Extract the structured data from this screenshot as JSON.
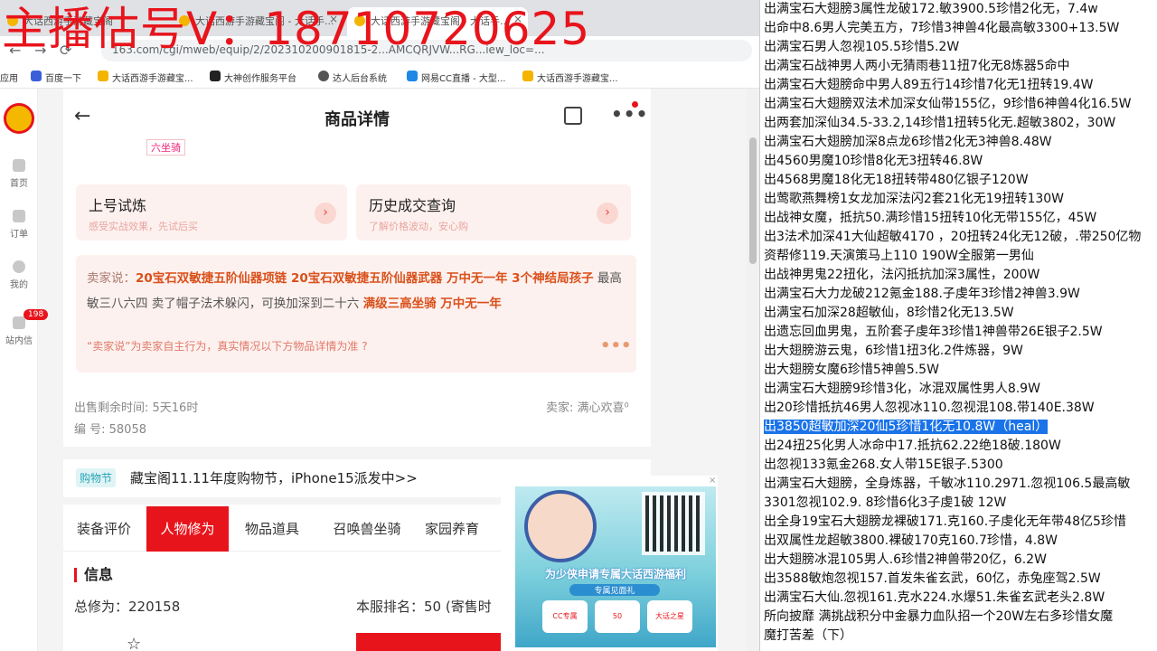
{
  "watermark": "主播估号V：18710720625",
  "browser": {
    "tabs": [
      {
        "label": "大话西游手游藏宝阁"
      },
      {
        "label": "大话西游手游藏宝阁 - 大话手..."
      },
      {
        "label": "大话西游手游藏宝阁 - 大话手..."
      }
    ],
    "url": "163.com/cgi/mweb/equip/2/202310200901815-2...AMCQRJVW...RG...iew_loc=...",
    "bookmarks": [
      "应用",
      "百度一下",
      "大话西游手游藏宝...",
      "大神创作服务平台",
      "达人后台系统",
      "网易CC直播 - 大型...",
      "大话西游手游藏宝..."
    ]
  },
  "sidenav": {
    "items": [
      {
        "label": "首页"
      },
      {
        "label": "订单"
      },
      {
        "label": "我的"
      },
      {
        "label": "站内信"
      }
    ],
    "message_badge": "198"
  },
  "detail": {
    "title": "商品详情",
    "back_icon": "arrow-left",
    "mount_tag": "六坐骑",
    "cards": [
      {
        "title": "上号试炼",
        "subtitle": "感受实战效果，先试后买",
        "arrow": "›"
      },
      {
        "title": "历史成交查询",
        "subtitle": "了解价格波动，安心购",
        "arrow": "›"
      }
    ],
    "seller_says": {
      "prefix": "卖家说：",
      "hl1": "20宝石双敏捷五阶仙器项链 20宝石双敏捷五阶仙器武器  万中无一年 3个神结局孩子",
      "plain1": " 最高敏三八六四 卖了帽子法术躲闪，可换加深到二十六 ",
      "hl2": "满级三高坐骑 万中无一年",
      "note": "“卖家说”为卖家自主行为，真实情况以下方物品详情为准",
      "note_icon": "?",
      "more": "•••"
    },
    "sale_time": "出售剩余时间: 5天16时",
    "seller": "卖家: 满心欢喜⁰",
    "serial": "编 号: 58058",
    "promo_tag": "购物节",
    "promo_text": "藏宝阁11.11年度购物节，iPhone15派发中>>",
    "tabs": [
      "装备评价",
      "人物修为",
      "物品道具",
      "召唤兽坐骑",
      "家园养育"
    ],
    "active_tab": "人物修为",
    "info_title": "信息",
    "total_cultivation": "总修为：220158",
    "server_rank": "本服排名：50 (寄售时"
  },
  "ad": {
    "headline": "为少侠申请专属大话西游福利",
    "sub": "专属见面礼",
    "prizes": [
      "CC专属",
      "50",
      "大话之星"
    ],
    "close": "×"
  },
  "panel": {
    "lines": [
      "出满宝石大翅膀3属性龙破172.敏3900.5珍惜2化无，7.4w",
      "出命中8.6男人完美五方，7珍惜3神兽4化最高敏3300+13.5W",
      "出满宝石男人忽视105.5珍惜5.2W",
      "出满宝石战神男人两小无猜雨巷11扭7化无8炼器5命中",
      "出满宝石大翅膀命中男人89五行14珍惜7化无1扭转19.4W",
      "出满宝石大翅膀双法术加深女仙带155亿，9珍惜6神兽4化16.5W",
      "出两套加深仙34.5-33.2,14珍惜1扭转5化无.超敏3802，30W",
      "出满宝石大翅膀加深8点龙6珍惜2化无3神兽8.48W",
      "出4560男魔10珍惜8化无3扭转46.8W",
      "出4568男魔18化无18扭转带480亿银子120W",
      "出莺歌燕舞榜1女龙加深法闪2套21化无19扭转130W",
      "出战神女魔，抵抗50.满珍惜15扭转10化无带155亿，45W",
      "出3法术加深41大仙超敏4170 ，20扭转24化无12破，.带250亿物",
      "资帮修119.天演策马上110 190W全服第一男仙",
      "出战神男鬼22扭化，法闪抵抗加深3属性，200W",
      "出满宝石大力龙破212氪金188.子虔年3珍惜2神兽3.9W",
      "出满宝石加深28超敏仙，8珍惜2化无13.5W",
      "出遗忘回血男鬼，五阶套子虔年3珍惜1神兽带26E银子2.5W",
      "出大翅膀游云鬼，6珍惜1扭3化.2件炼器，9W",
      "出大翅膀女魔6珍惜5神兽5.5W",
      "出满宝石大翅膀9珍惜3化，冰混双属性男人8.9W",
      "出20珍惜抵抗46男人忽视冰110.忽视混108.带140E.38W",
      "出3850超敏加深20仙5珍惜1化无10.8W（heal）",
      "出24扭25化男人冰命中17.抵抗62.22绝18破.180W",
      "出忽视133氪金268.女人带15E银子.5300",
      "出满宝石大翅膀，全身炼器，千敏冰110.2971.忽视106.5最高敏",
      "3301忽视102.9. 8珍惜6化3子虔1破  12W",
      "出全身19宝石大翅膀龙裸破171.克160.子虔化无年带48亿5珍惜",
      "出双属性龙超敏3800.裸破170克160.7珍惜，4.8W",
      "出大翅膀冰混105男人.6珍惜2神兽带20亿，6.2W",
      "出3588敏炮忽视157.首发朱雀玄武，60亿，赤兔座驾2.5W",
      "出满宝石大仙.忽视161.克水224.水爆51.朱雀玄武老头2.8W",
      "所向披靡 满挑战积分中金暴力血队招一个20W左右多珍惜女魔",
      "魔打苦差（下）"
    ],
    "selected_index": 22
  }
}
